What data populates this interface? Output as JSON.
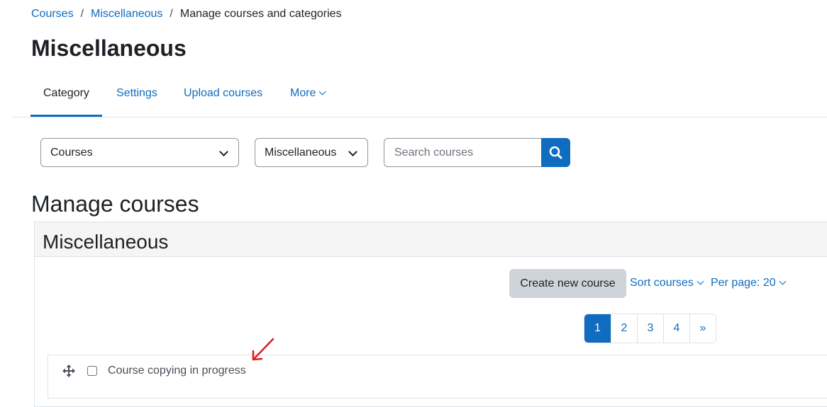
{
  "breadcrumb": {
    "items": [
      "Courses",
      "Miscellaneous"
    ],
    "separator": "/",
    "current": "Manage courses and categories"
  },
  "page": {
    "title": "Miscellaneous"
  },
  "tabs": [
    {
      "label": "Category",
      "active": true
    },
    {
      "label": "Settings"
    },
    {
      "label": "Upload courses"
    },
    {
      "label": "More"
    }
  ],
  "filters": {
    "view_select": "Courses",
    "category_select": "Miscellaneous",
    "search_placeholder": "Search courses",
    "search_icon": "search-icon"
  },
  "manage": {
    "heading": "Manage courses",
    "panel_title": "Miscellaneous",
    "create_label": "Create new course",
    "sort_label": "Sort courses",
    "perpage_label": "Per page: 20"
  },
  "pagination": {
    "pages": [
      "1",
      "2",
      "3",
      "4",
      "»"
    ],
    "current": "1"
  },
  "courses": [
    {
      "name": "Course copying in progress"
    }
  ],
  "colors": {
    "accent": "#0f6cbf",
    "annotation": "#e02020"
  }
}
